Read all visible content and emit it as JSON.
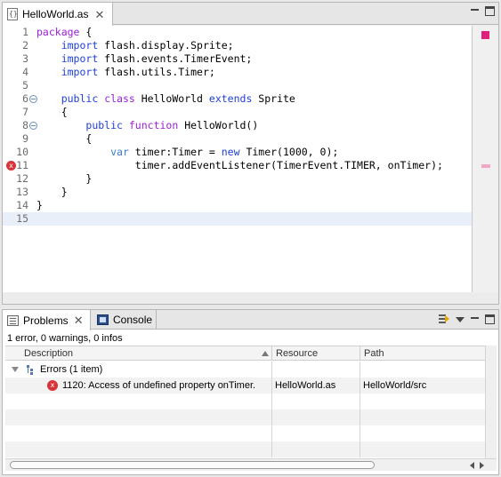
{
  "editor": {
    "tab_label": "HelloWorld.as",
    "lines": [
      {
        "n": "1",
        "html_parts": [
          [
            "kw",
            "package"
          ],
          [
            "",
            "{"
          ]
        ],
        "text": "package {"
      },
      {
        "n": "2",
        "text": "    import flash.display.Sprite;"
      },
      {
        "n": "3",
        "text": "    import flash.events.TimerEvent;"
      },
      {
        "n": "4",
        "text": "    import flash.utils.Timer;"
      },
      {
        "n": "5",
        "text": ""
      },
      {
        "n": "6",
        "text": "    public class HelloWorld extends Sprite"
      },
      {
        "n": "7",
        "text": "    {"
      },
      {
        "n": "8",
        "text": "        public function HelloWorld()"
      },
      {
        "n": "9",
        "text": "        {"
      },
      {
        "n": "10",
        "text": "            var timer:Timer = new Timer(1000, 0);"
      },
      {
        "n": "11",
        "text": "                timer.addEventListener(TimerEvent.TIMER, onTimer);"
      },
      {
        "n": "12",
        "text": "        }"
      },
      {
        "n": "13",
        "text": "    }"
      },
      {
        "n": "14",
        "text": "}"
      },
      {
        "n": "15",
        "text": ""
      }
    ],
    "error_marker_glyph": "x",
    "colors": {
      "keyword": "#9b1fd6",
      "keyword_blue": "#1f3fd6",
      "error": "#d9343a",
      "current_line": "#e9eff8"
    }
  },
  "problems": {
    "tab_label": "Problems",
    "console_label": "Console",
    "summary": "1 error, 0 warnings, 0 infos",
    "columns": {
      "description": "Description",
      "resource": "Resource",
      "path": "Path"
    },
    "group_label": "Errors (1 item)",
    "error": {
      "description": "1120: Access of undefined property onTimer.",
      "resource": "HelloWorld.as",
      "path": "HelloWorld/src"
    }
  }
}
